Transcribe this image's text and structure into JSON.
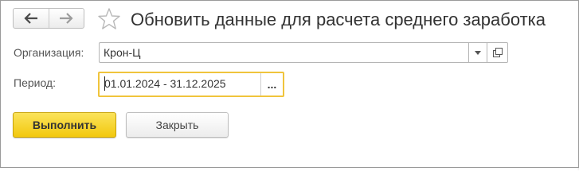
{
  "header": {
    "title": "Обновить данные для расчета среднего заработка",
    "back_icon": "arrow-left-icon",
    "forward_icon": "arrow-right-icon",
    "favorite_icon": "star-icon"
  },
  "form": {
    "organization": {
      "label": "Организация:",
      "value": "Крон-Ц"
    },
    "period": {
      "label": "Период:",
      "value": "01.01.2024 - 31.12.2025",
      "select_label": "..."
    }
  },
  "buttons": {
    "run_label": "Выполнить",
    "close_label": "Закрыть"
  },
  "colors": {
    "accent_yellow": "#f2c80e",
    "focus_border": "#f0c43c"
  }
}
